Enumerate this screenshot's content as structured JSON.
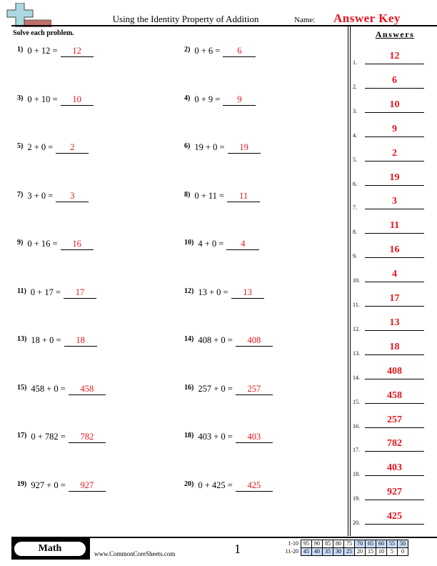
{
  "header": {
    "title": "Using the Identity Property of Addition",
    "name_label": "Name:",
    "name_value": "Answer Key",
    "logo_icon": "plus-and-bar-logo-icon"
  },
  "instructions": "Solve each problem.",
  "answers_title": "Answers",
  "problems": [
    {
      "num": "1)",
      "expr": "0 + 12 =",
      "answer": "12"
    },
    {
      "num": "2)",
      "expr": "0 + 6 =",
      "answer": "6"
    },
    {
      "num": "3)",
      "expr": "0 + 10 =",
      "answer": "10"
    },
    {
      "num": "4)",
      "expr": "0 + 9 =",
      "answer": "9"
    },
    {
      "num": "5)",
      "expr": "2 + 0 =",
      "answer": "2"
    },
    {
      "num": "6)",
      "expr": "19 + 0 =",
      "answer": "19"
    },
    {
      "num": "7)",
      "expr": "3 + 0 =",
      "answer": "3"
    },
    {
      "num": "8)",
      "expr": "0 + 11 =",
      "answer": "11"
    },
    {
      "num": "9)",
      "expr": "0 + 16 =",
      "answer": "16"
    },
    {
      "num": "10)",
      "expr": "4 + 0 =",
      "answer": "4"
    },
    {
      "num": "11)",
      "expr": "0 + 17 =",
      "answer": "17"
    },
    {
      "num": "12)",
      "expr": "13 + 0 =",
      "answer": "13"
    },
    {
      "num": "13)",
      "expr": "18 + 0 =",
      "answer": "18"
    },
    {
      "num": "14)",
      "expr": "408 + 0 =",
      "answer": "408"
    },
    {
      "num": "15)",
      "expr": "458 + 0 =",
      "answer": "458"
    },
    {
      "num": "16)",
      "expr": "257 + 0 =",
      "answer": "257"
    },
    {
      "num": "17)",
      "expr": "0 + 782 =",
      "answer": "782"
    },
    {
      "num": "18)",
      "expr": "403 + 0 =",
      "answer": "403"
    },
    {
      "num": "19)",
      "expr": "927 + 0 =",
      "answer": "927"
    },
    {
      "num": "20)",
      "expr": "0 + 425 =",
      "answer": "425"
    }
  ],
  "answer_key": [
    {
      "n": "1.",
      "v": "12"
    },
    {
      "n": "2.",
      "v": "6"
    },
    {
      "n": "3.",
      "v": "10"
    },
    {
      "n": "4.",
      "v": "9"
    },
    {
      "n": "5.",
      "v": "2"
    },
    {
      "n": "6.",
      "v": "19"
    },
    {
      "n": "7.",
      "v": "3"
    },
    {
      "n": "8.",
      "v": "11"
    },
    {
      "n": "9.",
      "v": "16"
    },
    {
      "n": "10.",
      "v": "4"
    },
    {
      "n": "11.",
      "v": "17"
    },
    {
      "n": "12.",
      "v": "13"
    },
    {
      "n": "13.",
      "v": "18"
    },
    {
      "n": "14.",
      "v": "408"
    },
    {
      "n": "15.",
      "v": "458"
    },
    {
      "n": "16.",
      "v": "257"
    },
    {
      "n": "17.",
      "v": "782"
    },
    {
      "n": "18.",
      "v": "403"
    },
    {
      "n": "19.",
      "v": "927"
    },
    {
      "n": "20.",
      "v": "425"
    }
  ],
  "footer": {
    "subject": "Math",
    "site": "www.CommonCoreSheets.com",
    "page": "1",
    "score_rows": [
      {
        "label": "1-10",
        "values": [
          "95",
          "90",
          "85",
          "80",
          "75",
          "70",
          "65",
          "60",
          "55",
          "50"
        ],
        "highlight": [
          false,
          false,
          false,
          false,
          false,
          true,
          true,
          true,
          true,
          true
        ]
      },
      {
        "label": "11-20",
        "values": [
          "45",
          "40",
          "35",
          "30",
          "25",
          "20",
          "15",
          "10",
          "5",
          "0"
        ],
        "highlight": [
          true,
          true,
          true,
          true,
          true,
          false,
          false,
          false,
          false,
          false
        ]
      }
    ]
  }
}
